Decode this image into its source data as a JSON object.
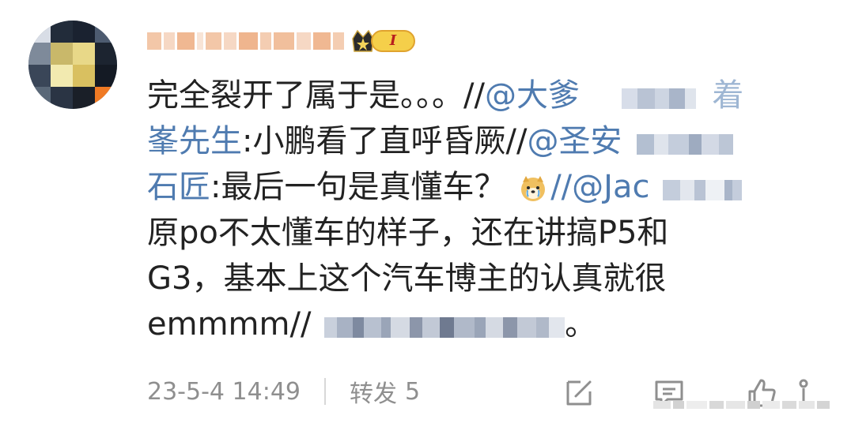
{
  "post": {
    "content": {
      "line1": {
        "text": "完全裂开了属于是。。。//",
        "mention": "@大爹"
      },
      "line2": {
        "mention": "峯先生",
        "text": ":小鹏看了直呼昏厥//",
        "mention2": "@圣安"
      },
      "line3": {
        "mention": "石匠",
        "text": ":最后一句是真懂车？",
        "emoji": "doge-cry-emoji",
        "slashes": "//",
        "mention2": "@Jac"
      },
      "line4": "原po不太懂车的样子，还在讲搞P5和",
      "line5": "G3，基本上这个汽车博主的认真就很",
      "line6": {
        "text": "emmmm//",
        "end": "。"
      }
    },
    "badge": {
      "level": "I",
      "icon": "crown-star-icon"
    },
    "footer": {
      "timestamp": "23-5-4 14:49",
      "repost_label": "转发",
      "repost_count": "5",
      "icons": [
        "share-edit-icon",
        "comment-icon",
        "like-icon"
      ]
    }
  },
  "colors": {
    "mention": "#4f7bb0",
    "text": "#222222",
    "meta": "#8f8f8f",
    "badge_fill": "#f5cf4a",
    "badge_text": "#b81e1e"
  }
}
